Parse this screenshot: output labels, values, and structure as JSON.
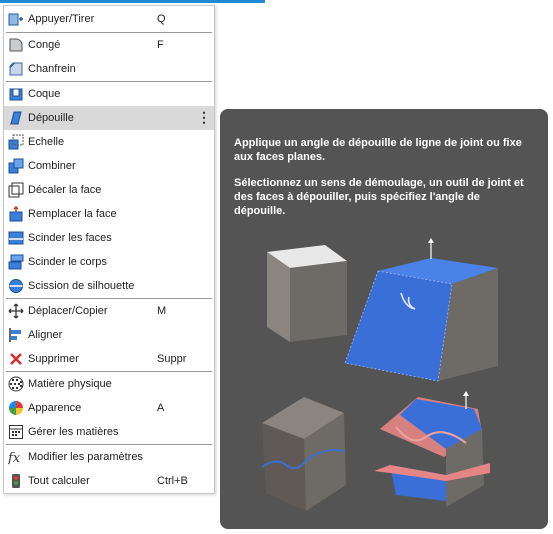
{
  "menu": {
    "items": [
      {
        "label": "Appuyer/Tirer",
        "shortcut": "Q",
        "icon": "push-pull-icon"
      },
      {
        "label": "Congé",
        "shortcut": "F",
        "icon": "fillet-icon"
      },
      {
        "label": "Chanfrein",
        "shortcut": "",
        "icon": "chamfer-icon"
      },
      {
        "label": "Coque",
        "shortcut": "",
        "icon": "shell-icon"
      },
      {
        "label": "Dépouille",
        "shortcut": "",
        "icon": "draft-icon",
        "highlighted": true,
        "more": "⋮"
      },
      {
        "label": "Echelle",
        "shortcut": "",
        "icon": "scale-icon"
      },
      {
        "label": "Combiner",
        "shortcut": "",
        "icon": "combine-icon"
      },
      {
        "label": "Décaler la face",
        "shortcut": "",
        "icon": "offset-face-icon"
      },
      {
        "label": "Remplacer la face",
        "shortcut": "",
        "icon": "replace-face-icon"
      },
      {
        "label": "Scinder les faces",
        "shortcut": "",
        "icon": "split-face-icon"
      },
      {
        "label": "Scinder le corps",
        "shortcut": "",
        "icon": "split-body-icon"
      },
      {
        "label": "Scission de silhouette",
        "shortcut": "",
        "icon": "silhouette-split-icon"
      },
      {
        "label": "Déplacer/Copier",
        "shortcut": "M",
        "icon": "move-icon"
      },
      {
        "label": "Aligner",
        "shortcut": "",
        "icon": "align-icon"
      },
      {
        "label": "Supprimer",
        "shortcut": "Suppr",
        "icon": "delete-icon"
      },
      {
        "label": "Matière physique",
        "shortcut": "",
        "icon": "physical-material-icon"
      },
      {
        "label": "Apparence",
        "shortcut": "A",
        "icon": "appearance-icon"
      },
      {
        "label": "Gérer les matières",
        "shortcut": "",
        "icon": "manage-materials-icon"
      },
      {
        "label": "Modifier les paramètres",
        "shortcut": "",
        "icon": "change-parameters-icon"
      },
      {
        "label": "Tout calculer",
        "shortcut": "Ctrl+B",
        "icon": "compute-all-icon"
      }
    ]
  },
  "tooltip": {
    "description": "Applique un angle de dépouille de ligne de joint ou fixe aux faces planes.",
    "instructions": "Sélectionnez un sens de démoulage, un outil de joint et des faces à dépouiller, puis spécifiez l'angle de dépouille."
  },
  "colors": {
    "accent": "#1f8ad6",
    "highlight": "#d9d9d9",
    "tooltip_bg": "#545454",
    "face_blue": "#3a6fd8",
    "face_grey": "#6e6a66",
    "parting_red": "#e58585"
  }
}
